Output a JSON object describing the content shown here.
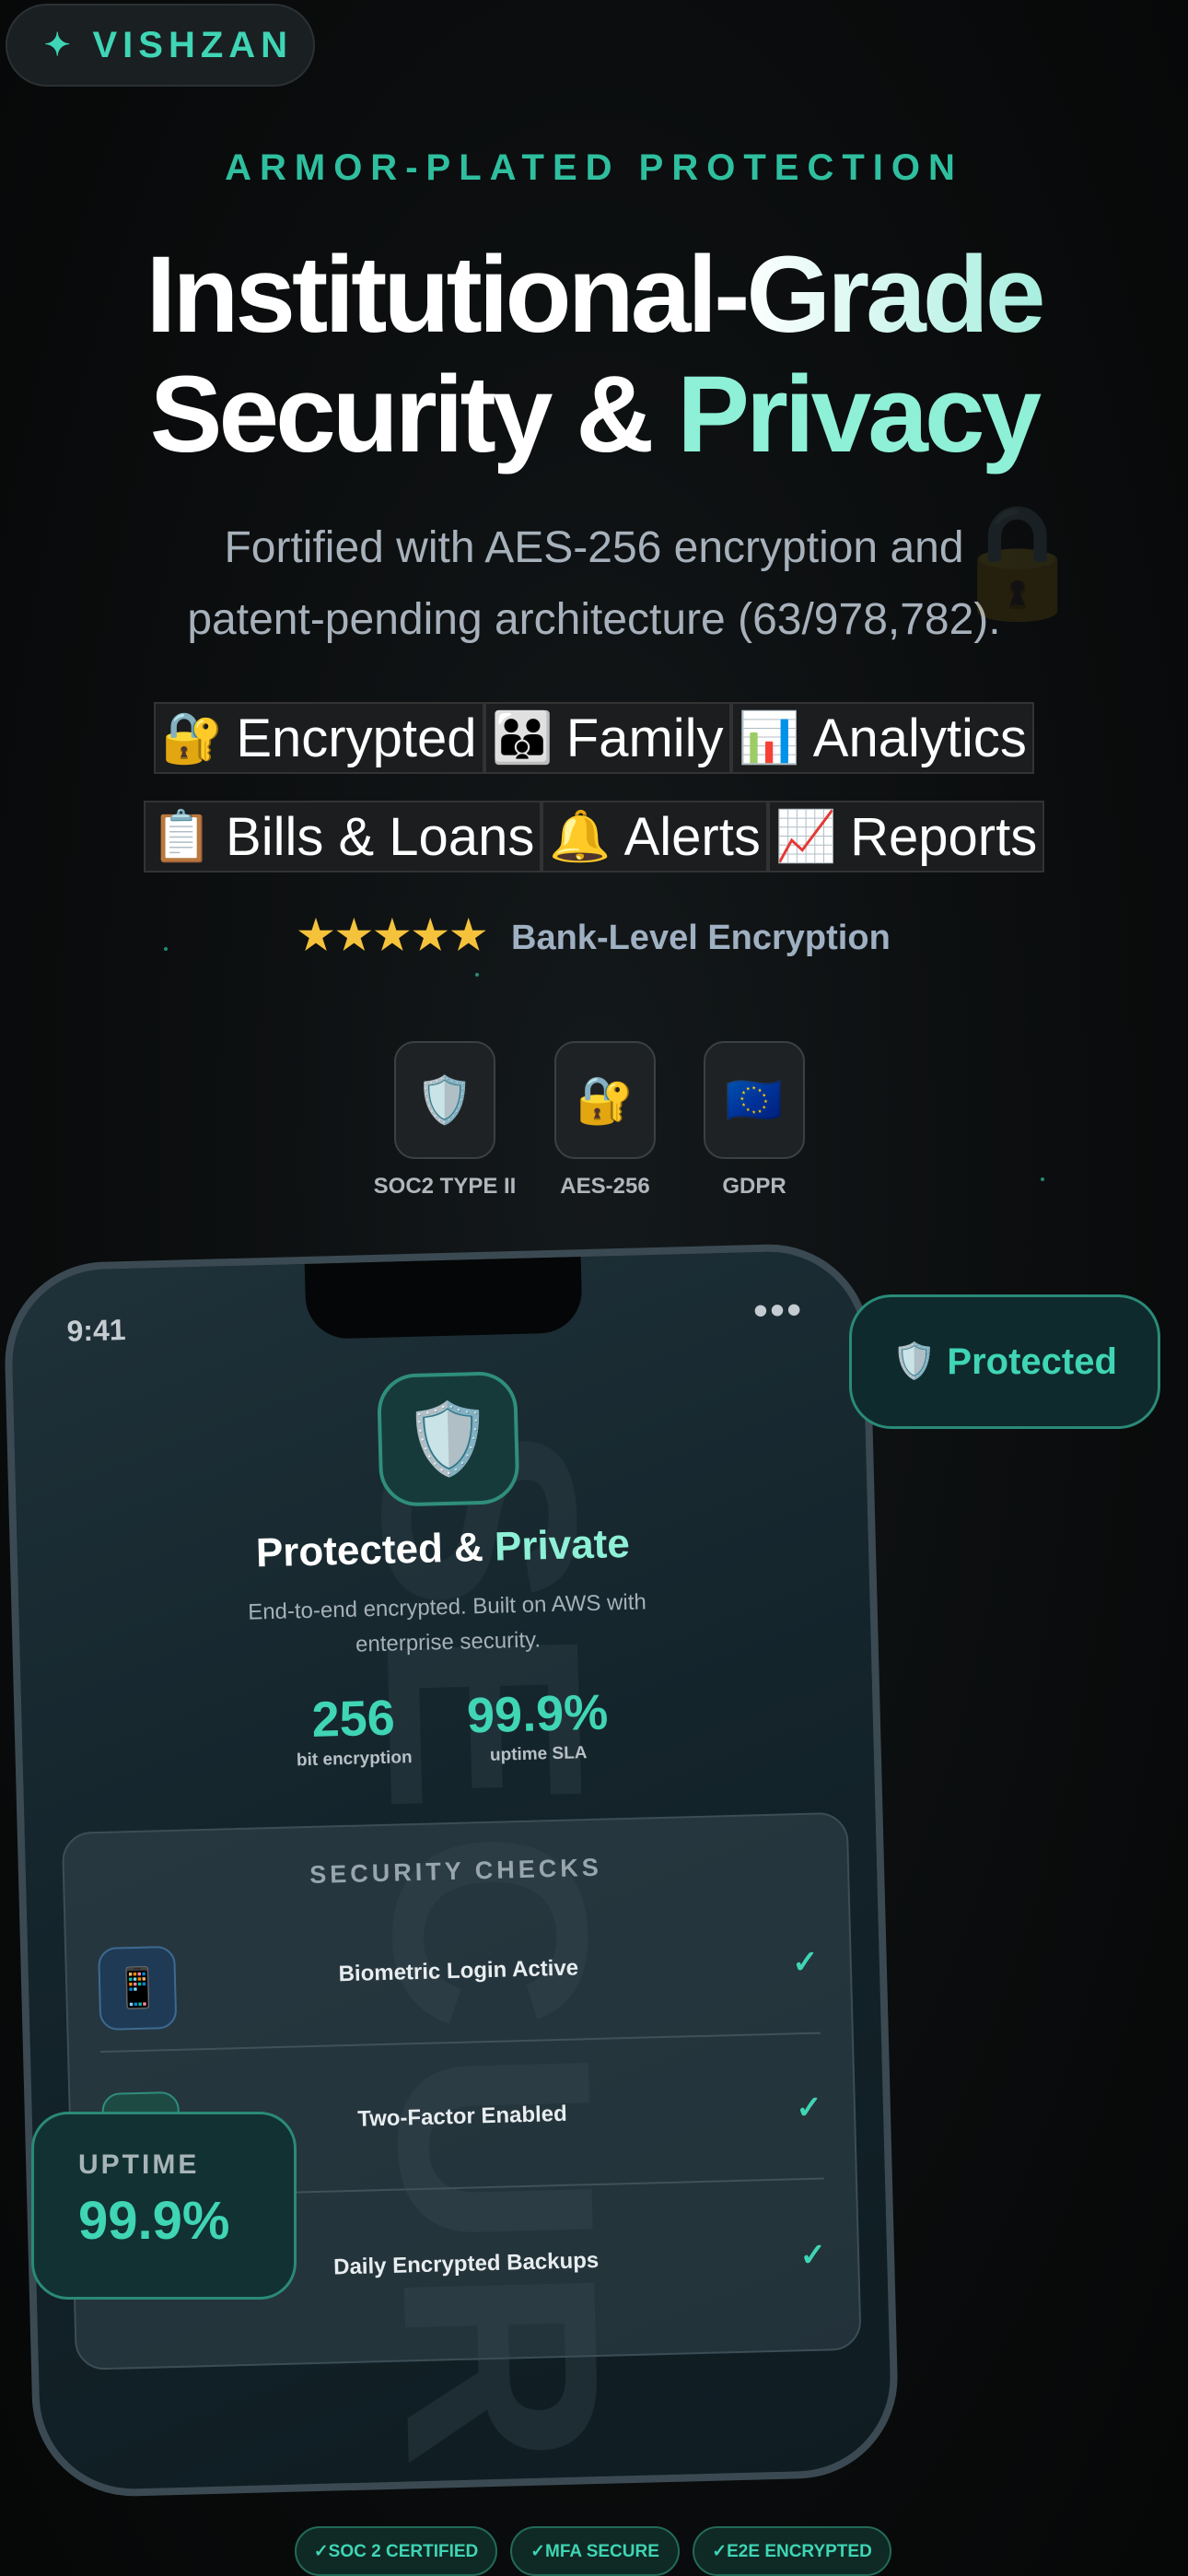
{
  "brand": {
    "icon": "sparkle-icon",
    "name": "VISHZAN"
  },
  "hero": {
    "eyebrow": "ARMOR-PLATED PROTECTION",
    "title_line1": "Institutional-Grade",
    "title_line2_a": "Security &",
    "title_line2_b": "Privacy",
    "subtitle_line1": "Fortified with AES-256 encryption and",
    "subtitle_line2": "patent-pending architecture (63/978,782)."
  },
  "features": [
    {
      "icon": "🔐",
      "icon_name": "locked-with-key-icon",
      "label": "Encrypted"
    },
    {
      "icon": "👪",
      "icon_name": "family-icon",
      "label": "Family"
    },
    {
      "icon": "📊",
      "icon_name": "bar-chart-icon",
      "label": "Analytics"
    },
    {
      "icon": "📋",
      "icon_name": "clipboard-icon",
      "label": "Bills & Loans"
    },
    {
      "icon": "🔔",
      "icon_name": "bell-icon",
      "label": "Alerts"
    },
    {
      "icon": "📈",
      "icon_name": "trend-chart-icon",
      "label": "Reports"
    }
  ],
  "rating": {
    "stars": "★★★★★",
    "star_count": 5,
    "label": "Bank-Level Encryption"
  },
  "certs": [
    {
      "icon": "🛡️",
      "icon_name": "shield-icon",
      "label": "SOC2 TYPE II"
    },
    {
      "icon": "🔐",
      "icon_name": "lock-icon",
      "label": "AES-256"
    },
    {
      "icon": "🇪🇺",
      "icon_name": "eu-flag-icon",
      "label": "GDPR"
    }
  ],
  "phone": {
    "time": "9:41",
    "menu": "•••",
    "watermark": "SECURE",
    "shield_icon": "🛡️",
    "title_a": "Protected &",
    "title_b": "Private",
    "subtitle_line1": "End-to-end encrypted. Built on AWS with",
    "subtitle_line2": "enterprise security.",
    "stats": [
      {
        "value": "256",
        "caption": "bit encryption"
      },
      {
        "value": "99.9%",
        "caption": "uptime SLA"
      }
    ],
    "checks_title": "SECURITY CHECKS",
    "checks": [
      {
        "icon": "📱",
        "icon_name": "phone-icon",
        "label": "Biometric Login Active",
        "status": "✓"
      },
      {
        "icon": "🔑",
        "icon_name": "key-icon",
        "label": "Two-Factor Enabled",
        "status": "✓"
      },
      {
        "icon": "💾",
        "icon_name": "backup-icon",
        "label": "Daily Encrypted Backups",
        "status": "✓"
      }
    ]
  },
  "float_badge": {
    "icon": "🛡️",
    "label": "Protected"
  },
  "uptime_card": {
    "label": "UPTIME",
    "value": "99.9%"
  },
  "footer_badges": [
    "✓SOC 2 CERTIFIED",
    "✓MFA SECURE",
    "✓E2E ENCRYPTED"
  ],
  "colors": {
    "accent": "#3fd5b5",
    "mint": "#8ef0d6",
    "background": "#0b0d0e",
    "star": "#f5c33b"
  }
}
